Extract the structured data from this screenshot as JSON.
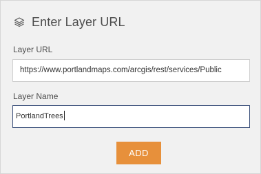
{
  "header": {
    "title": "Enter Layer URL",
    "icon": "layers-icon"
  },
  "form": {
    "url_label": "Layer URL",
    "url_value": "https://www.portlandmaps.com/arcgis/rest/services/Public",
    "name_label": "Layer Name",
    "name_value": "PortlandTrees",
    "add_button_label": "ADD"
  },
  "colors": {
    "accent": "#e7903b",
    "focus_border": "#3a4f7a",
    "panel_bg": "#f1f1f1"
  }
}
